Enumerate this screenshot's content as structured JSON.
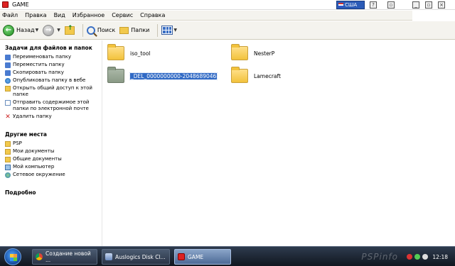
{
  "window": {
    "title": "GAME",
    "language": "США"
  },
  "menu": [
    "Файл",
    "Правка",
    "Вид",
    "Избранное",
    "Сервис",
    "Справка"
  ],
  "toolbar": {
    "back_label": "Назад",
    "search_label": "Поиск",
    "folders_label": "Папки"
  },
  "sidebar": {
    "tasks_title": "Задачи для файлов и папок",
    "tasks": [
      "Переименовать папку",
      "Переместить папку",
      "Скопировать папку",
      "Опубликовать папку в вебе",
      "Открыть общий доступ к этой папке",
      "Отправить содержимое этой папки по электронной почте",
      "Удалить папку"
    ],
    "places_title": "Другие места",
    "places": [
      "PSP",
      "Мои документы",
      "Общие документы",
      "Мой компьютер",
      "Сетевое окружение"
    ],
    "details_title": "Подробно"
  },
  "folders": [
    {
      "name": "iso_tool",
      "selected": false
    },
    {
      "name": "NesterP",
      "selected": false
    },
    {
      "name": "_DEL_0000000000-2048689046",
      "selected": true
    },
    {
      "name": "Lamecraft",
      "selected": false
    }
  ],
  "taskbar": {
    "buttons": [
      "Создание новой ...",
      "Auslogics Disk Cl...",
      "GAME"
    ],
    "clock": "12:18",
    "watermark": "PSPinfo"
  }
}
